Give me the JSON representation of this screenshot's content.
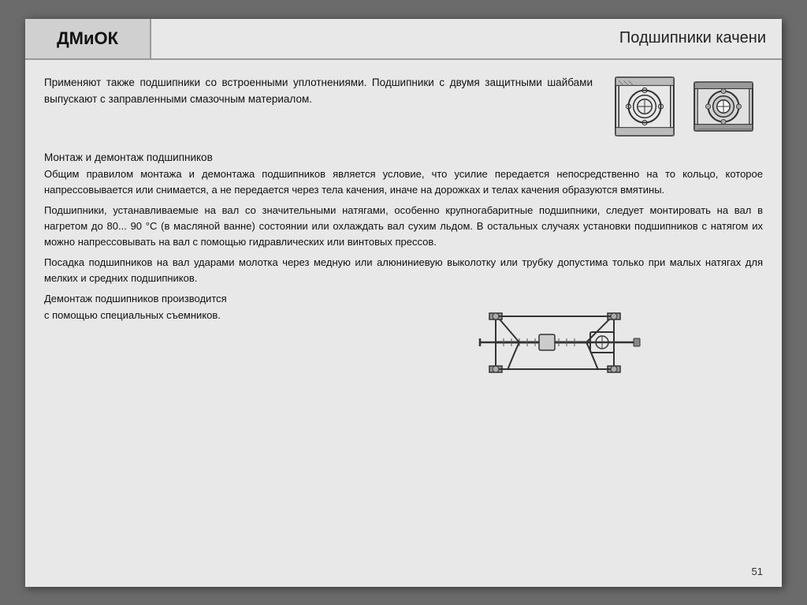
{
  "header": {
    "left_title": "ДМиОК",
    "right_title": "Подшипники качени"
  },
  "top_paragraph": "Применяют также подшипники со встроенными уплотнениями. Подшипники с двумя защитными шайбами выпускают с заправленными смазочным материалом.",
  "section_title": "Монтаж и демонтаж подшипников",
  "paragraph1": "Общим правилом монтажа и демонтажа подшипников является условие, что усилие передается непосредственно на то кольцо, которое напрессовывается или снимается, а не передается через тела качения, иначе на дорожках и телах качения образуются вмятины.",
  "paragraph2": "Подшипники, устанавливаемые на вал со значительными натягами, особенно крупногабаритные подшипники, следует монтировать на вал в нагретом до 80... 90 °С (в масляной ванне) состоянии или охлаждать вал сухим льдом. В остальных случаях установки подшипников с натягом их можно напрессовывать на вал с помощью гидравлических или винтовых прессов.",
  "paragraph3": "Посадка подшипников на вал ударами молотка через медную или алюниниевую выколотку или трубку допустима только при малых натягах для мелких и средних подшипников.",
  "bottom_text_line1": "Демонтаж подшипников производится",
  "bottom_text_line2": " с помощью специальных съемников.",
  "page_number": "51"
}
